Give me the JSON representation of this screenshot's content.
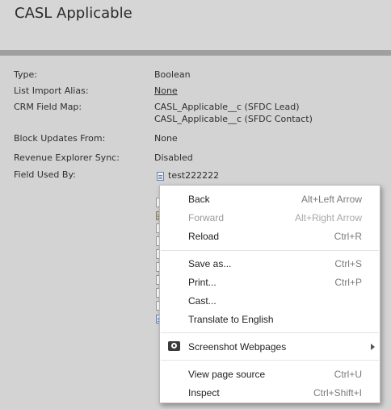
{
  "header": {
    "title": "CASL Applicable"
  },
  "fields": [
    {
      "label": "Type:",
      "value": "Boolean"
    },
    {
      "label": "List Import Alias:",
      "value": "None"
    },
    {
      "label": "CRM Field Map:",
      "value": "CASL_Applicable__c (SFDC Lead)",
      "value2": "CASL_Applicable__c (SFDC Contact)"
    },
    {
      "label": "Block Updates From:",
      "value": "None"
    },
    {
      "label": "Revenue Explorer Sync:",
      "value": "Disabled"
    },
    {
      "label": "Field Used By:",
      "value": "test222222"
    }
  ],
  "context_menu": {
    "items": [
      {
        "label": "Back",
        "shortcut": "Alt+Left Arrow"
      },
      {
        "label": "Forward",
        "shortcut": "Alt+Right Arrow",
        "disabled": true
      },
      {
        "label": "Reload",
        "shortcut": "Ctrl+R"
      },
      {
        "label": "Save as...",
        "shortcut": "Ctrl+S"
      },
      {
        "label": "Print...",
        "shortcut": "Ctrl+P"
      },
      {
        "label": "Cast..."
      },
      {
        "label": "Translate to English"
      },
      {
        "label": "Screenshot Webpages",
        "icon": "camera-icon",
        "submenu": true
      },
      {
        "label": "View page source",
        "shortcut": "Ctrl+U"
      },
      {
        "label": "Inspect",
        "shortcut": "Ctrl+Shift+I"
      }
    ]
  }
}
